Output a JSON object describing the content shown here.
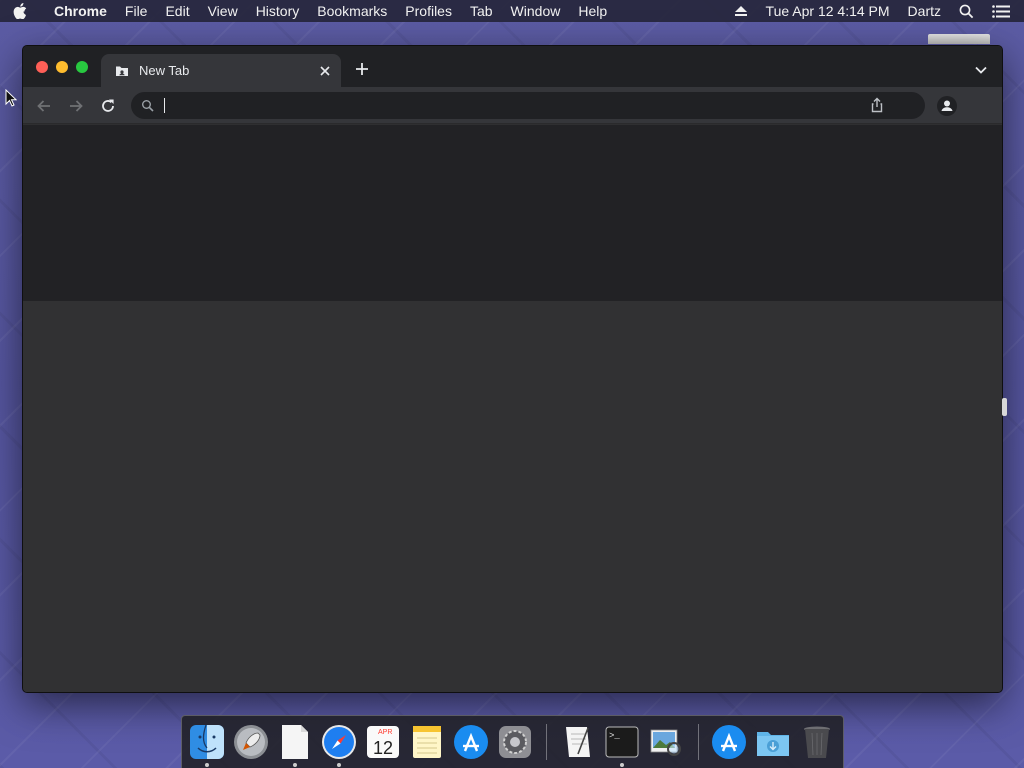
{
  "menubar": {
    "app_name": "Chrome",
    "menus": [
      "File",
      "Edit",
      "View",
      "History",
      "Bookmarks",
      "Profiles",
      "Tab",
      "Window",
      "Help"
    ],
    "datetime": "Tue Apr 12  4:14 PM",
    "user": "Dartz",
    "icons": [
      "apple-icon",
      "eject-icon",
      "spotlight-search-icon",
      "control-center-icon"
    ]
  },
  "browser": {
    "tab": {
      "title": "New Tab",
      "favicon": "new-tab-icon"
    },
    "omnibox": {
      "value": "",
      "placeholder": ""
    },
    "colors": {
      "tabstrip": "#202124",
      "toolbar": "#35363a",
      "content_top": "#222225",
      "content_bottom": "#313133"
    }
  },
  "dock": {
    "apps": [
      "Finder",
      "Launchpad",
      "Document",
      "Safari",
      "Calendar",
      "Notes",
      "App Store",
      "System Preferences",
      "TextEdit",
      "Terminal",
      "Preview",
      "App Store",
      "Downloads",
      "Trash"
    ],
    "calendar": {
      "month": "APR",
      "day": "12"
    },
    "terminal_prompt": ">_"
  }
}
